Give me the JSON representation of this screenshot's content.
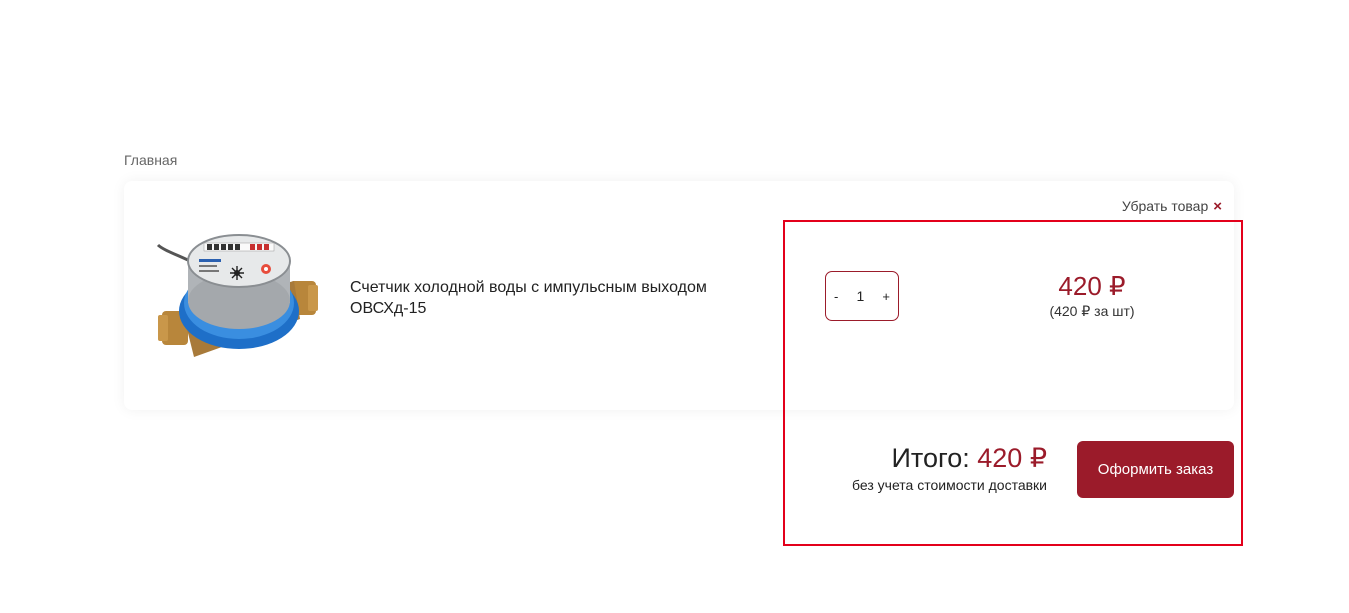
{
  "breadcrumb": {
    "home": "Главная"
  },
  "cart": {
    "remove_label": "Убрать товар",
    "remove_icon": "×",
    "item": {
      "image_icon": "water-meter-image",
      "name": "Счетчик холодной воды с импульсным выходом ОВСХд-15",
      "quantity": "1",
      "minus_label": "-",
      "plus_label": "+",
      "price": "420 ₽",
      "unit_price": "(420 ₽ за шт)"
    }
  },
  "summary": {
    "total_label": "Итого:",
    "total_value": "420 ₽",
    "note": "без учета стоимости доставки",
    "checkout_label": "Оформить заказ"
  },
  "colors": {
    "accent": "#9b1b2a",
    "highlight": "#e3001b"
  }
}
